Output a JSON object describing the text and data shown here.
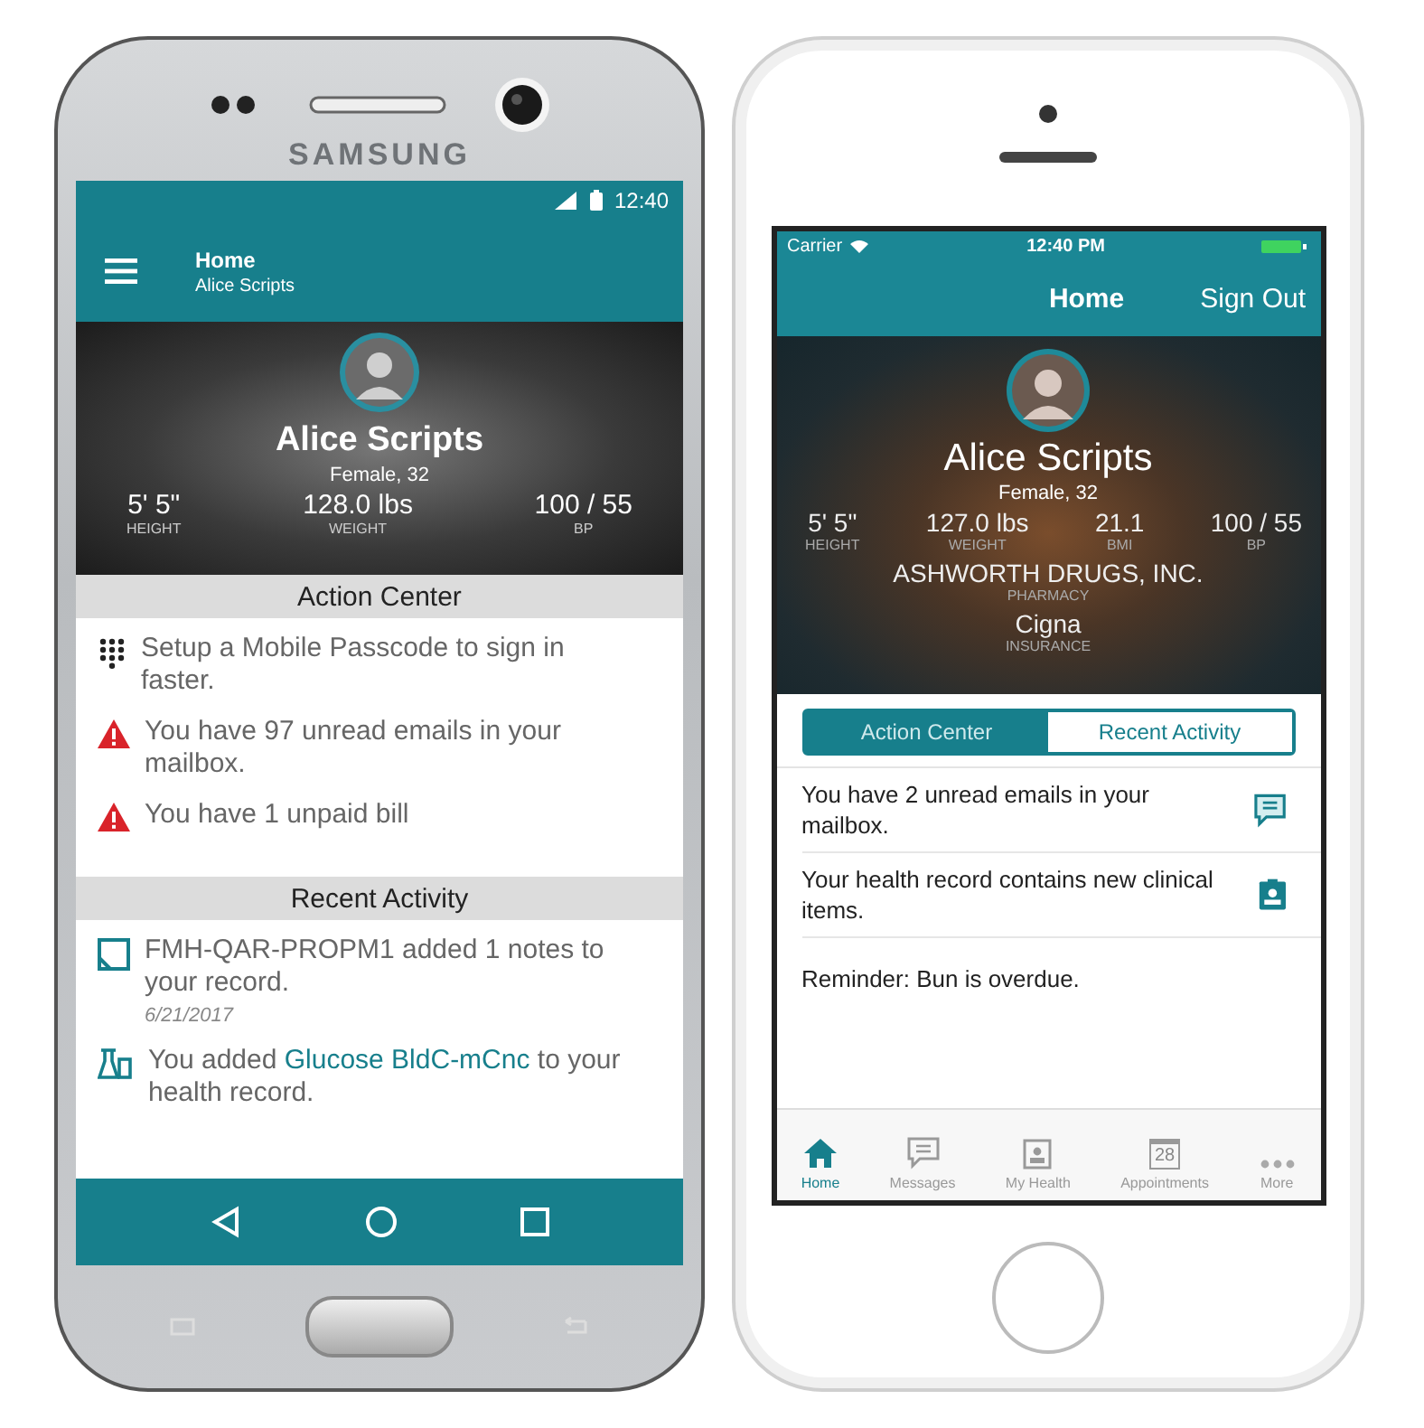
{
  "android": {
    "brand": "SAMSUNG",
    "status": {
      "time": "12:40"
    },
    "app_bar": {
      "title": "Home",
      "subtitle": "Alice Scripts"
    },
    "profile": {
      "name": "Alice Scripts",
      "details": "Female, 32",
      "stats": [
        {
          "value": "5' 5\"",
          "label": "HEIGHT"
        },
        {
          "value": "128.0 lbs",
          "label": "WEIGHT"
        },
        {
          "value": "100 / 55",
          "label": "BP"
        }
      ]
    },
    "action_center": {
      "title": "Action Center",
      "items": [
        {
          "kind": "passcode",
          "text": "Setup a Mobile Passcode to sign in faster."
        },
        {
          "kind": "alert",
          "text": "You have 97 unread emails in your mailbox."
        },
        {
          "kind": "alert",
          "text": "You have 1 unpaid bill"
        }
      ]
    },
    "recent_activity": {
      "title": "Recent Activity",
      "items": [
        {
          "kind": "note",
          "text": "FMH-QAR-PROPM1 added 1 notes to your record.",
          "date": "6/21/2017"
        },
        {
          "kind": "lab",
          "text_before": "You added",
          "link": "Glucose BldC-mCnc",
          "text_after": "to your health record."
        }
      ]
    }
  },
  "iphone": {
    "status": {
      "carrier": "Carrier",
      "time": "12:40 PM"
    },
    "nav": {
      "title": "Home",
      "action": "Sign Out"
    },
    "profile": {
      "name": "Alice Scripts",
      "details": "Female, 32",
      "stats": [
        {
          "value": "5' 5\"",
          "label": "HEIGHT"
        },
        {
          "value": "127.0 lbs",
          "label": "WEIGHT"
        },
        {
          "value": "21.1",
          "label": "BMI"
        },
        {
          "value": "100 / 55",
          "label": "BP"
        }
      ],
      "pharmacy": {
        "value": "ASHWORTH DRUGS, INC.",
        "label": "PHARMACY"
      },
      "insurance": {
        "value": "Cigna",
        "label": "INSURANCE"
      }
    },
    "segments": [
      {
        "label": "Action Center",
        "selected": true
      },
      {
        "label": "Recent Activity",
        "selected": false
      }
    ],
    "items": [
      {
        "kind": "message",
        "text": "You have 2 unread emails in your mailbox."
      },
      {
        "kind": "record",
        "text": "Your health record contains new clinical items."
      },
      {
        "kind": "reminder",
        "text": "Reminder: Bun is overdue."
      }
    ],
    "tabs": [
      {
        "kind": "home",
        "label": "Home",
        "selected": true
      },
      {
        "kind": "messages",
        "label": "Messages",
        "selected": false
      },
      {
        "kind": "health",
        "label": "My Health",
        "selected": false
      },
      {
        "kind": "calendar",
        "label": "Appointments",
        "selected": false,
        "icon_text": "28"
      },
      {
        "kind": "more",
        "label": "More",
        "selected": false
      }
    ]
  }
}
